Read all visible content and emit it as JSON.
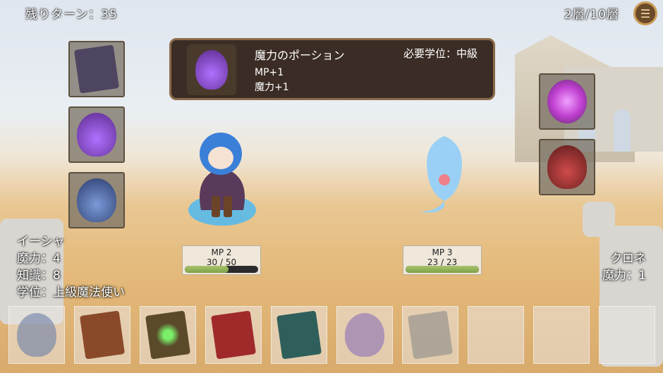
{
  "hud": {
    "turns_left": "残りターン：35",
    "floor": "2層/10層",
    "menu_icon": "list-icon"
  },
  "tooltip": {
    "item_name": "魔力のポーション",
    "requirement": "必要学位：中級",
    "effects": [
      "MP+1",
      "魔力+1"
    ]
  },
  "left_items": [
    {
      "icon": "spellbook-dark-icon",
      "color": "#4e4560"
    },
    {
      "icon": "mana-potion-icon",
      "color": "#7a3fbf"
    },
    {
      "icon": "ice-flask-icon",
      "color": "#3a5a9a"
    }
  ],
  "right_items": [
    {
      "icon": "vortex-spell-icon",
      "color": "#c040d0"
    },
    {
      "icon": "fire-flask-icon",
      "color": "#9a2a2a"
    }
  ],
  "player": {
    "name": "イーシャ",
    "magic": "魔力：4",
    "knowledge": "知識：8",
    "rank": "学位：上級魔法使い",
    "mp_label": "MP 2",
    "mp_value": "30 / 50",
    "mp_fraction": 0.6
  },
  "enemy": {
    "name": "クロネ",
    "magic": "魔力：1",
    "mp_label": "MP 3",
    "mp_value": "23 / 23",
    "mp_fraction": 1.0
  },
  "hand": [
    {
      "icon": "ice-flask-icon",
      "color": "#6b7fa8",
      "faded": true
    },
    {
      "icon": "brown-book-icon",
      "color": "#8a4a2a",
      "faded": false
    },
    {
      "icon": "emerald-book-icon",
      "color": "#5a4a2a",
      "faded": false
    },
    {
      "icon": "red-book-icon",
      "color": "#a02a2a",
      "faded": false
    },
    {
      "icon": "teal-book-icon",
      "color": "#2f5f5a",
      "faded": false
    },
    {
      "icon": "mana-potion-icon",
      "color": "#8a70b8",
      "faded": true
    },
    {
      "icon": "grey-book-icon",
      "color": "#8a8a8a",
      "faded": true
    },
    {
      "icon": "empty-slot",
      "color": "",
      "faded": true
    },
    {
      "icon": "empty-slot",
      "color": "",
      "faded": true
    },
    {
      "icon": "empty-slot",
      "color": "",
      "faded": true
    }
  ]
}
